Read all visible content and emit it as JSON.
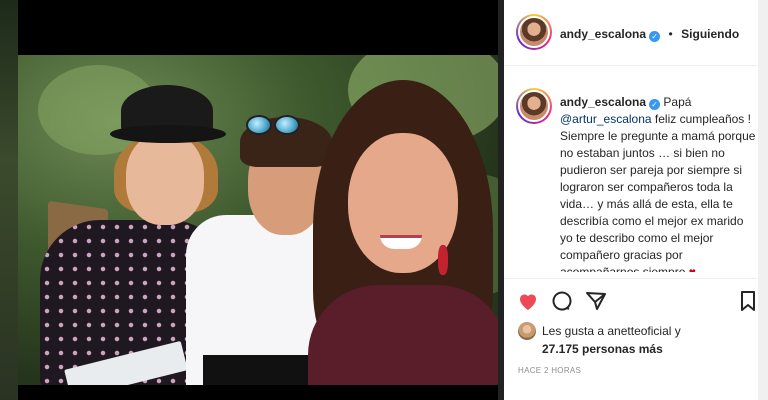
{
  "post": {
    "username": "andy_escalona",
    "follow_status": "Siguiendo",
    "separator": "•",
    "verified_mark": "✓",
    "caption": {
      "prefix": "Papá",
      "mention": "@artur_escalona",
      "body": "feliz cumpleaños ! Siempre le pregunte a mamá porque no estaban juntos … si bien no pudieron ser pareja por siempre si lograron ser compañeros toda la vida… y más allá de esta, ella te describía como el mejor ex marido yo te describo como el mejor compañero gracias por acompañarnos siempre",
      "emoji": "♥"
    },
    "likes": {
      "line1": "Les gusta a anetteoficial y",
      "line2": "27.175 personas más"
    },
    "time_ago": "HACE 2 HORAS"
  },
  "icons": {
    "like": "heart-icon",
    "comment": "comment-icon",
    "share": "share-icon",
    "save": "bookmark-icon",
    "verified": "verified-badge-icon"
  },
  "colors": {
    "like_red": "#ed4956",
    "verified_blue": "#3897f0",
    "mention_blue": "#003569"
  }
}
